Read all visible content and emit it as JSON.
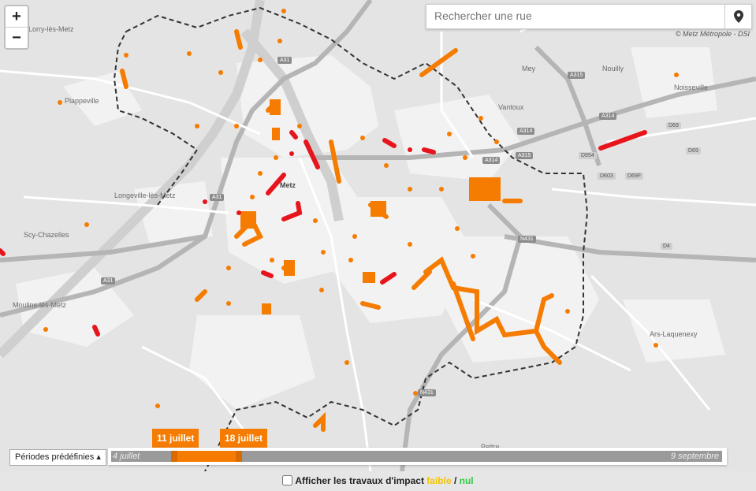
{
  "zoom": {
    "in_label": "+",
    "out_label": "−"
  },
  "search": {
    "placeholder": "Rechercher une rue",
    "button_icon": "map-pin-icon"
  },
  "attribution": "© Metz Métropole - DSI",
  "places": {
    "lorry": "Lorry-lès-Metz",
    "plappeville": "Plappeville",
    "metz": "Metz",
    "longeville": "Longeville-lès-Metz",
    "scy": "Scy-Chazelles",
    "moulins": "Moulins-lès-Metz",
    "mey": "Mey",
    "nouilly": "Nouilly",
    "noisseville": "Noisseville",
    "vantoux": "Vantoux",
    "ars": "Ars-Laquenexy",
    "peltre": "Peltre"
  },
  "roads": {
    "a31_north": "A31",
    "a315": "A315",
    "a314_a": "A314",
    "a314_b": "A314",
    "a315_b": "A315",
    "a314_c": "A314",
    "d69_a": "D69",
    "d69_b": "D69",
    "d954": "D954",
    "d603": "D603",
    "d69f": "D69F",
    "d4": "D4",
    "n431": "N431",
    "a31_west": "A31",
    "a31_left": "A31",
    "n431_south": "N431"
  },
  "colors": {
    "high_impact": "#e8141b",
    "medium_impact": "#f57c00",
    "low_impact": "#f5c400",
    "no_impact": "#2ecc40",
    "border": "#333333"
  },
  "timeline": {
    "presets_label": "Périodes prédéfinies ▴",
    "start_label": "4 juillet",
    "end_label": "9 septembre",
    "range_start_label": "11 juillet",
    "range_end_label": "18 juillet"
  },
  "footer": {
    "text_before": "Afficher les travaux d'impact ",
    "low_label": "faible",
    "sep": " / ",
    "zero_label": "nul"
  }
}
